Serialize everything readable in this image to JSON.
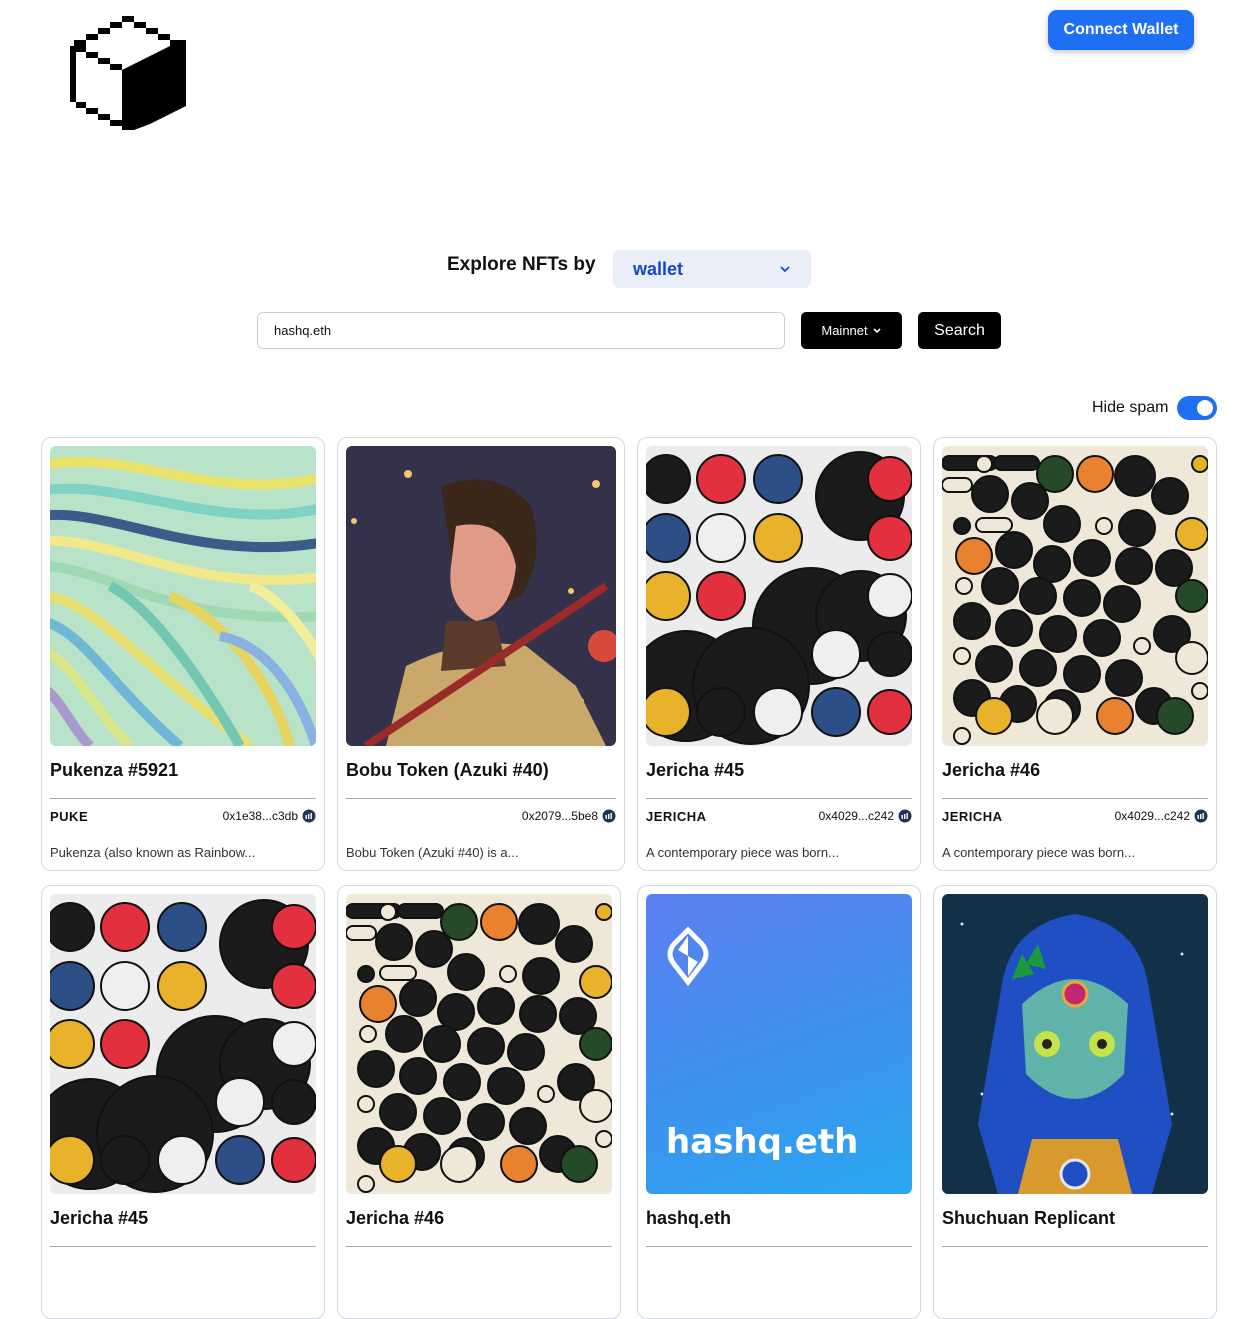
{
  "header": {
    "connect_label": "Connect Wallet"
  },
  "explore": {
    "label": "Explore NFTs by",
    "mode": "wallet"
  },
  "search": {
    "value": "hashq.eth",
    "network": "Mainnet",
    "button": "Search"
  },
  "filters": {
    "hide_spam_label": "Hide spam",
    "hide_spam": true
  },
  "colors": {
    "accent": "#1f6ff2",
    "select_text": "#1249c8",
    "select_bg": "#e9eef9"
  },
  "cards": [
    {
      "title": "Pukenza #5921",
      "symbol": "PUKE",
      "address": "0x1e38...c3db",
      "description": "Pukenza (also known as Rainbow..."
    },
    {
      "title": "Bobu Token (Azuki #40)",
      "symbol": "",
      "address": "0x2079...5be8",
      "description": "Bobu Token (Azuki #40) is a..."
    },
    {
      "title": "Jericha #45",
      "symbol": "JERICHA",
      "address": "0x4029...c242",
      "description": "A contemporary piece was born..."
    },
    {
      "title": "Jericha #46",
      "symbol": "JERICHA",
      "address": "0x4029...c242",
      "description": "A contemporary piece was born..."
    },
    {
      "title": "Jericha #45",
      "symbol": "",
      "address": "",
      "description": ""
    },
    {
      "title": "Jericha #46",
      "symbol": "",
      "address": "",
      "description": ""
    },
    {
      "title": "hashq.eth",
      "symbol": "",
      "address": "",
      "description": "",
      "art_text": "hashq.eth"
    },
    {
      "title": "Shuchuan Replicant",
      "symbol": "",
      "address": "",
      "description": ""
    }
  ]
}
